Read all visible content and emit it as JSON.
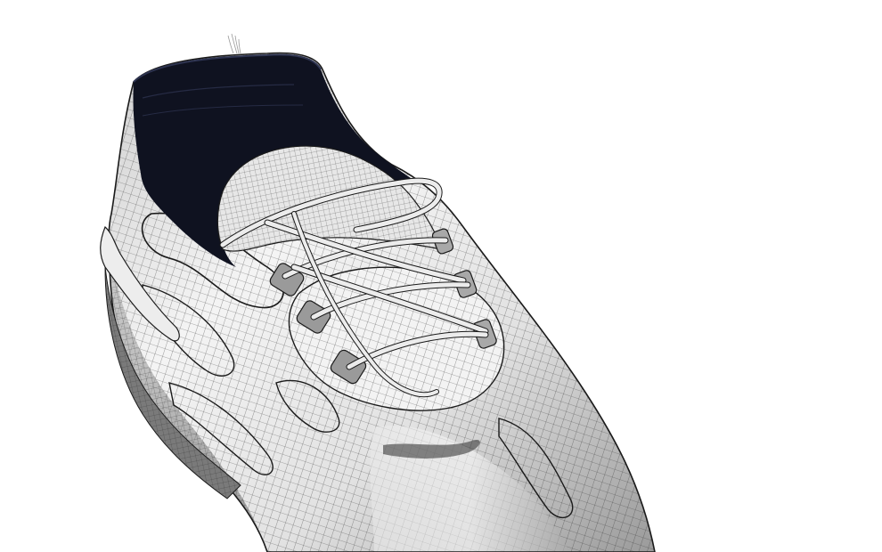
{
  "scene": {
    "subject": "shoe-wireframe-render",
    "colors": {
      "background": "#ffffff",
      "collar_lining": "#0f1220",
      "upper_light": "#f2f2f2",
      "upper_mid": "#d8d8d8",
      "upper_shadow": "#8a8a8a",
      "mesh_line": "#2a2a2a",
      "lace": "#e9e9e9"
    }
  }
}
